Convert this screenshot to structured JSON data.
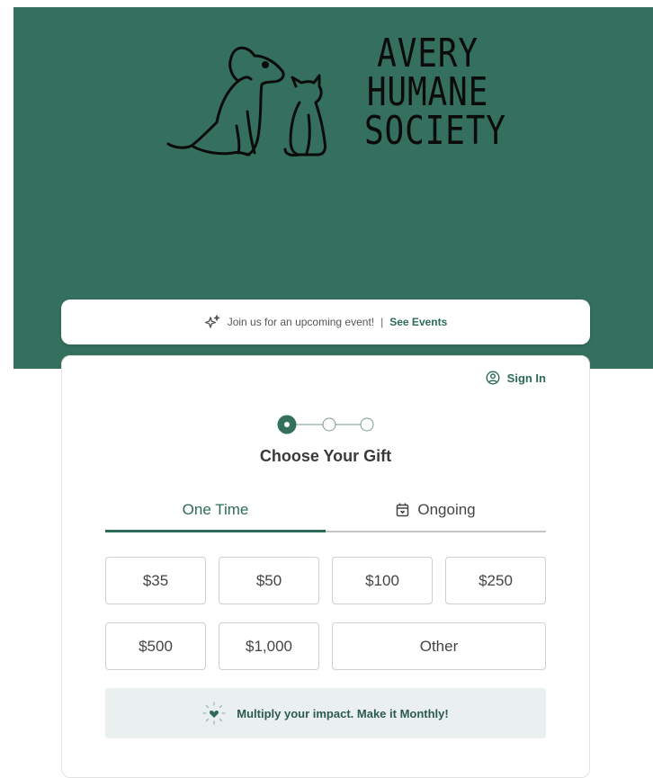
{
  "brand": {
    "logo_lines": [
      "AVERY",
      "HUMANE",
      "SOCIETY"
    ],
    "hero_color": "#356f5e",
    "accent_color": "#2c6b59"
  },
  "event_banner": {
    "icon": "sparkles-icon",
    "text": "Join us for an upcoming event!",
    "separator": "|",
    "link": "See Events"
  },
  "account": {
    "signin_label": "Sign In",
    "icon": "user-circle-icon"
  },
  "stepper": {
    "current_step": 1,
    "total_steps": 3
  },
  "form": {
    "title": "Choose Your Gift",
    "tabs": [
      {
        "label": "One Time",
        "active": true
      },
      {
        "label": "Ongoing",
        "active": false,
        "icon": "calendar-icon"
      }
    ],
    "amounts": [
      "$35",
      "$50",
      "$100",
      "$250",
      "$500",
      "$1,000"
    ],
    "other_label": "Other",
    "monthly_cta": {
      "icon": "heart-sparkle-icon",
      "text": "Multiply your impact. Make it Monthly!"
    }
  }
}
